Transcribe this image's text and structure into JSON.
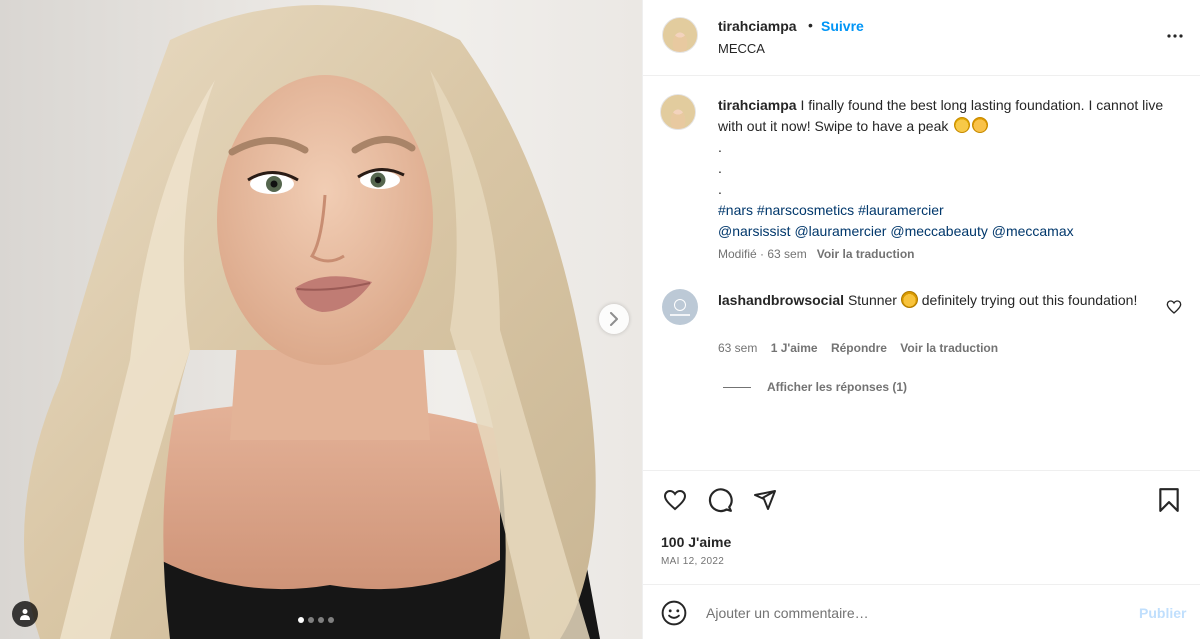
{
  "header": {
    "username": "tirahciampa",
    "separator": "•",
    "follow_label": "Suivre",
    "location": "MECCA",
    "more_icon": "more-horizontal-icon"
  },
  "caption": {
    "username": "tirahciampa",
    "text": "I finally found the best long lasting foundation. I cannot live with out it now! Swipe to have a peak",
    "dot1": ".",
    "dot2": ".",
    "dot3": ".",
    "hashtags": [
      "#nars",
      "#narscosmetics",
      "#lauramercier"
    ],
    "mentions": [
      "@narsissist",
      "@lauramercier",
      "@meccabeauty",
      "@meccamax"
    ],
    "edited_label": "Modifié · 63 sem",
    "translate_label": "Voir la traduction"
  },
  "comment": {
    "username": "lashandbrowsocial",
    "text_before": "Stunner",
    "text_after": "definitely trying out this foundation!",
    "time": "63 sem",
    "likes": "1 J'aime",
    "reply_label": "Répondre",
    "translate_label": "Voir la traduction",
    "view_replies": "Afficher les réponses (1)"
  },
  "stats": {
    "likes": "100 J'aime",
    "date": "MAI 12, 2022"
  },
  "add_comment": {
    "placeholder": "Ajouter un commentaire…",
    "post_label": "Publier"
  },
  "carousel": {
    "slide_count": 4,
    "active_index": 0
  },
  "colors": {
    "accent": "#0095f6",
    "link": "#00376b",
    "muted": "#737373",
    "post_disabled": "#c0dffd"
  }
}
